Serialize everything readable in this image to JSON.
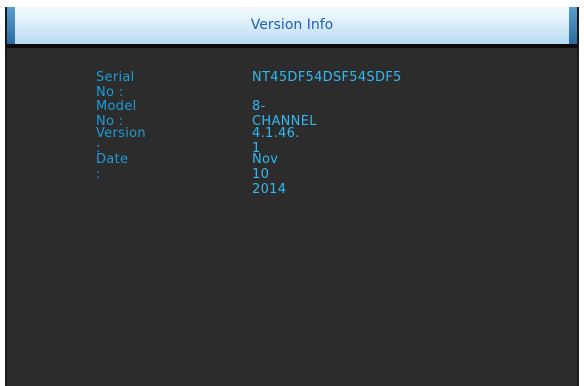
{
  "window": {
    "title": "Version Info"
  },
  "info": {
    "serial_label": "Serial No :",
    "serial_value": "NT45DF54DSF54SDF5",
    "model_label": "Model No :",
    "model_value": "8-CHANNEL",
    "version_label": "Version :",
    "version_value": "4.1.46. 1",
    "date_label": "Date :",
    "date_value": "Nov 10 2014"
  },
  "colors": {
    "label": "#1e9bd6",
    "value": "#33b8f0",
    "title": "#1f5fb0",
    "background": "#2c2c2c"
  }
}
